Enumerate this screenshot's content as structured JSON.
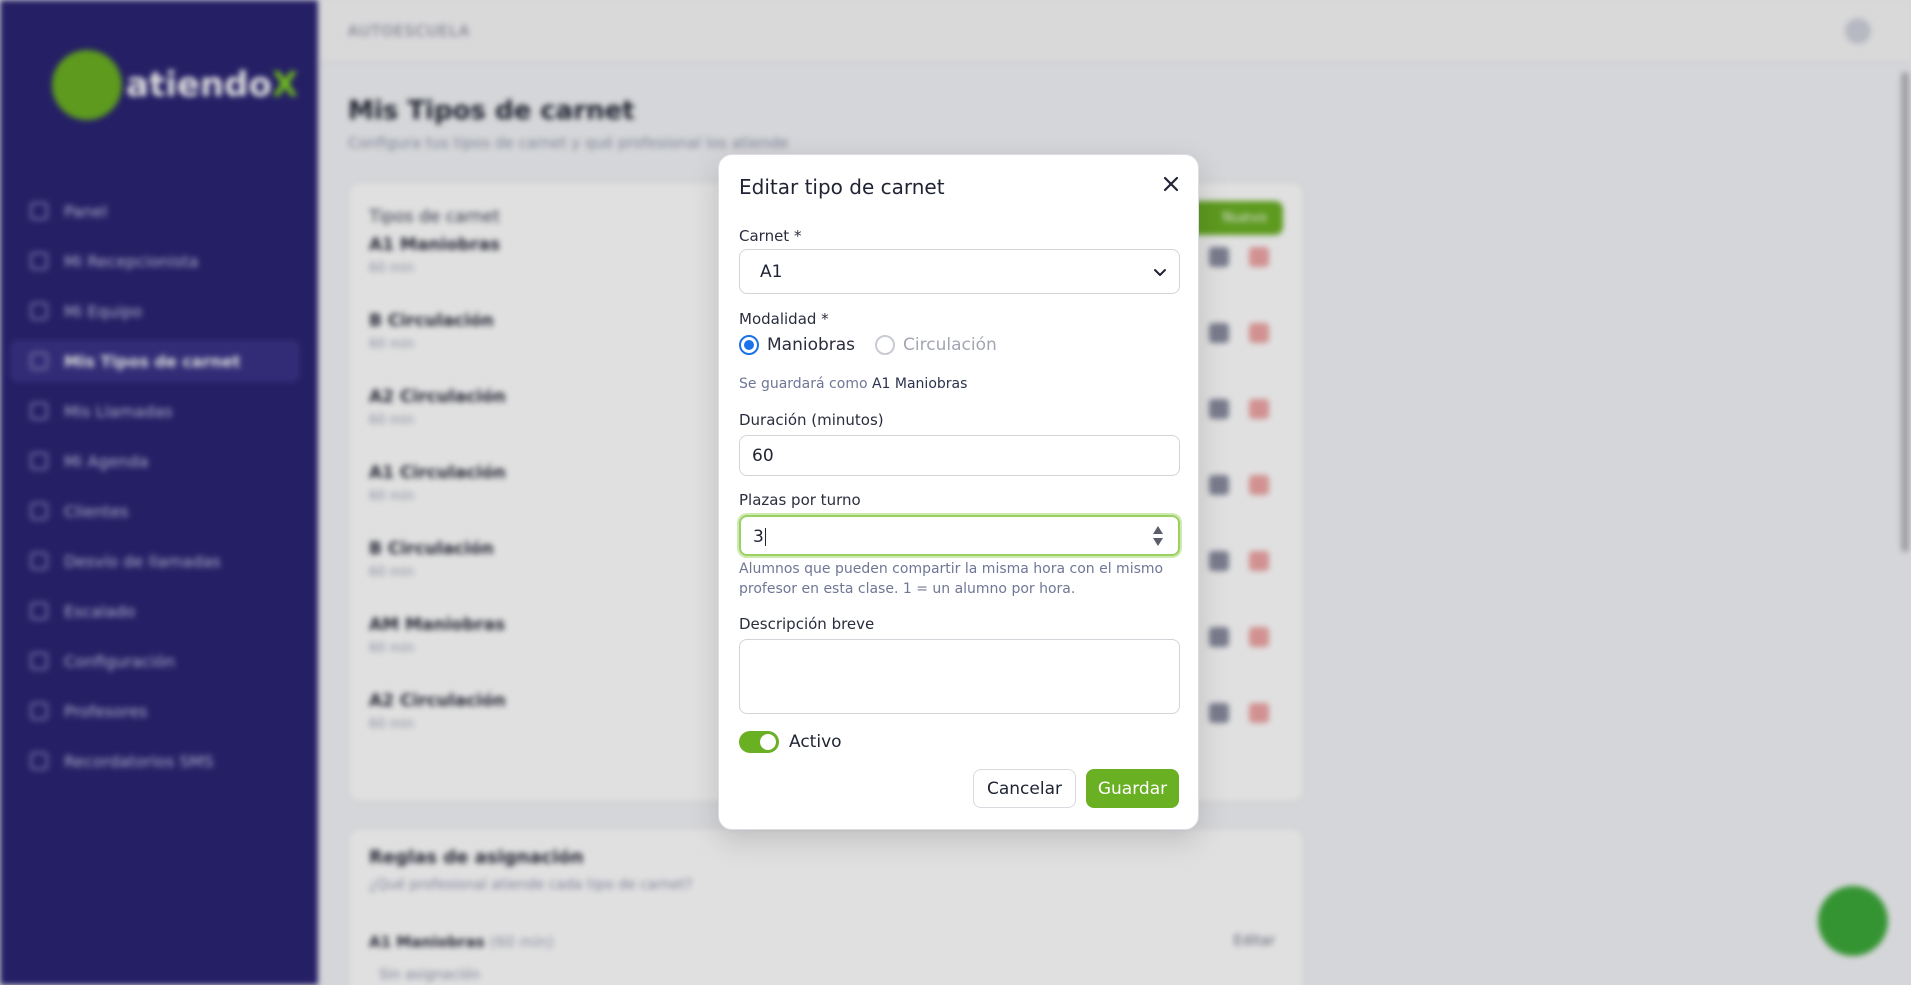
{
  "app": {
    "brand": {
      "name": "atiendo",
      "accent": "X"
    },
    "topbar": {
      "title": "AUTOESCUELA"
    },
    "nav": [
      {
        "label": "Panel",
        "active": false
      },
      {
        "label": "Mi Recepcionista",
        "active": false
      },
      {
        "label": "Mi Equipo",
        "active": false
      },
      {
        "label": "Mis Tipos de carnet",
        "active": true
      },
      {
        "label": "Mis Llamadas",
        "active": false
      },
      {
        "label": "Mi Agenda",
        "active": false
      },
      {
        "label": "Clientes",
        "active": false
      },
      {
        "label": "Desvío de llamadas",
        "active": false
      },
      {
        "label": "Escalado",
        "active": false
      },
      {
        "label": "Configuración",
        "active": false
      },
      {
        "label": "Profesores",
        "active": false
      },
      {
        "label": "Recordatorios SMS",
        "active": false
      }
    ],
    "page": {
      "title": "Mis Tipos de carnet",
      "subtitle": "Configura tus tipos de carnet y qué profesional los atiende"
    },
    "types_card": {
      "title": "Tipos de carnet",
      "new_button": "Nuevo",
      "rows": [
        {
          "name": "A1 Maniobras",
          "meta": "60 min"
        },
        {
          "name": "B Circulación",
          "meta": "60 min"
        },
        {
          "name": "A2 Circulación",
          "meta": "60 min"
        },
        {
          "name": "A1 Circulación",
          "meta": "60 min"
        },
        {
          "name": "B Circulación",
          "meta": "60 min"
        },
        {
          "name": "AM Maniobras",
          "meta": "60 min"
        },
        {
          "name": "A2 Circulación",
          "meta": "60 min"
        }
      ]
    },
    "rules_card": {
      "title": "Reglas de asignación",
      "subtitle": "¿Qué profesional atiende cada tipo de carnet?",
      "row_name": "A1 Maniobras",
      "row_meta": "(60 min)",
      "edit_label": "Editar",
      "assignment": "Sin asignación"
    }
  },
  "modal": {
    "title": "Editar tipo de carnet",
    "carnet": {
      "label": "Carnet *",
      "value": "A1"
    },
    "modalidad": {
      "label": "Modalidad *",
      "options": [
        {
          "label": "Maniobras",
          "selected": true
        },
        {
          "label": "Circulación",
          "selected": false
        }
      ]
    },
    "save_hint": {
      "prefix": "Se guardará como",
      "value": "A1 Maniobras"
    },
    "duracion": {
      "label": "Duración (minutos)",
      "value": "60"
    },
    "plazas": {
      "label": "Plazas por turno",
      "value": "3",
      "hint": "Alumnos que pueden compartir la misma hora con el mismo profesor en esta clase. 1 = un alumno por hora."
    },
    "descripcion": {
      "label": "Descripción breve",
      "value": ""
    },
    "activo": {
      "label": "Activo",
      "on": true
    },
    "buttons": {
      "cancel": "Cancelar",
      "save": "Guardar"
    }
  },
  "colors": {
    "sidebar": "#2b2474",
    "brand_green": "#6ab023",
    "radio_blue": "#1a73e8",
    "focus_ring": "#9bd163"
  },
  "icons": [
    "logo-icon",
    "nav-icon",
    "avatar-icon",
    "close-icon",
    "chevron-down-icon",
    "spin-arrows-icon",
    "edit-icon",
    "trash-icon",
    "help-icon"
  ]
}
